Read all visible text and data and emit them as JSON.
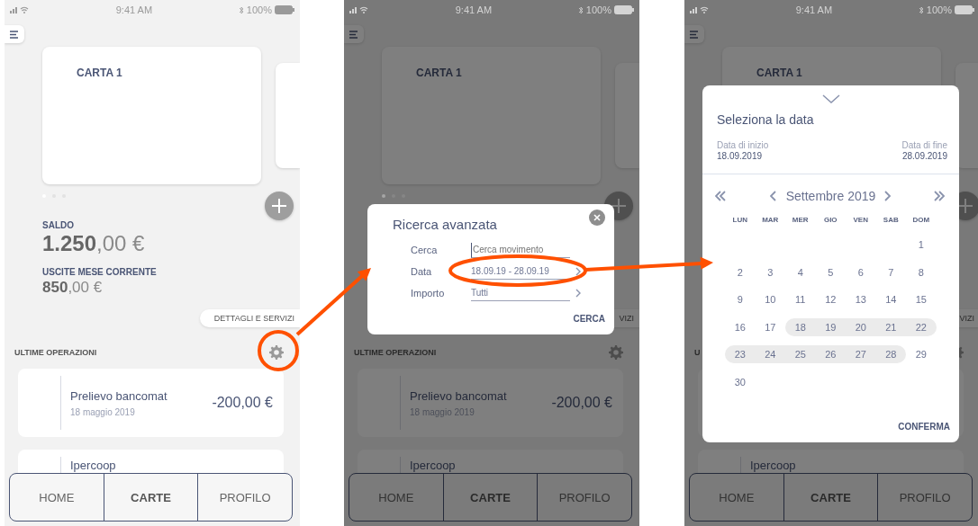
{
  "screens": [
    {
      "status_bar": {
        "time": "9:41 AM",
        "battery": "100%"
      },
      "card_title": "CARTA 1",
      "page_dots": [
        {
          "selected": true
        },
        {
          "selected": false
        },
        {
          "selected": false
        }
      ],
      "balance": {
        "label": "SALDO",
        "amount": "**1.250**,00 €"
      },
      "monthly_expenses": {
        "label": "USCITE MESE CORRENTE",
        "amount": "**850**,00 €"
      },
      "details_button": "DETTAGLI E SERVIZI",
      "operations_title": "ULTIME OPERAZIONI",
      "operations": [
        {
          "kind": "transaction",
          "title": "Prelievo bancomat",
          "date": "18 maggio 2019",
          "amount": "-200,00 €"
        },
        {
          "kind": "transaction",
          "title": "Ipercoop"
        }
      ],
      "nav": [
        {
          "label": "HOME",
          "selected": false
        },
        {
          "label": "CARTE",
          "selected": true
        },
        {
          "label": "PROFILO",
          "selected": false
        }
      ]
    },
    {
      "status_bar": {
        "time": "9:41 AM",
        "battery": "100%"
      },
      "card_title": "CARTA 1",
      "page_dots": [
        {
          "selected": true
        },
        {
          "selected": false
        },
        {
          "selected": false
        }
      ],
      "details_button": "VIZI",
      "operations_title": "ULTIME OPERAZIONI",
      "operations": [
        {
          "kind": "transaction",
          "title": "Prelievo bancomat",
          "date": "18 maggio 2019",
          "amount": "-200,00 €"
        },
        {
          "kind": "transaction",
          "title": "Ipercoop"
        }
      ],
      "nav": [
        {
          "label": "HOME",
          "selected": false
        },
        {
          "label": "CARTE",
          "selected": true
        },
        {
          "label": "PROFILO",
          "selected": false
        }
      ],
      "dialog": {
        "kind": "search",
        "title": "Ricerca avanzata",
        "fields": [
          {
            "label": "Cerca",
            "placeholder": "Cerca movimento"
          },
          {
            "label": "Data",
            "value": "18.09.19 - 28.09.19"
          },
          {
            "label": "Importo",
            "value": "Tutti"
          }
        ],
        "action": "CERCA"
      }
    },
    {
      "status_bar": {
        "time": "9:41 AM",
        "battery": "100%"
      },
      "card_title": "CARTA 1",
      "details_button": "VIZI",
      "operations_title": "U",
      "operations": [
        {
          "kind": "transaction"
        },
        {
          "kind": "transaction",
          "title": "Ipercoop"
        }
      ],
      "nav": [
        {
          "label": "HOME",
          "selected": false
        },
        {
          "label": "CARTE",
          "selected": true
        },
        {
          "label": "PROFILO",
          "selected": false
        }
      ],
      "dialog": {
        "kind": "date_picker",
        "title": "Seleziona la data",
        "start": {
          "label": "Data di inizio",
          "value": "18.09.2019"
        },
        "end": {
          "label": "Data di fine",
          "value": "28.09.2019"
        },
        "month": "Settembre 2019",
        "weekdays": [
          "LUN",
          "MAR",
          "MER",
          "GIO",
          "VEN",
          "SAB",
          "DOM"
        ],
        "weeks": [
          {
            "days": [
              {
                "day": "1",
                "in_range": false
              }
            ]
          },
          {
            "days": [
              {
                "day": "2",
                "in_range": false
              },
              {
                "day": "3",
                "in_range": false
              },
              {
                "day": "4",
                "in_range": false
              },
              {
                "day": "5",
                "in_range": false
              },
              {
                "day": "6",
                "in_range": false
              },
              {
                "day": "7",
                "in_range": false
              },
              {
                "day": "8",
                "in_range": false
              }
            ]
          },
          {
            "days": [
              {
                "day": "9",
                "in_range": false
              },
              {
                "day": "10",
                "in_range": false
              },
              {
                "day": "11",
                "in_range": false
              },
              {
                "day": "12",
                "in_range": false
              },
              {
                "day": "13",
                "in_range": false
              },
              {
                "day": "14",
                "in_range": false
              },
              {
                "day": "15",
                "in_range": false
              }
            ]
          },
          {
            "days": [
              {
                "day": "16",
                "in_range": false
              },
              {
                "day": "17",
                "in_range": false
              },
              {
                "day": "18",
                "in_range": true
              },
              {
                "day": "19",
                "in_range": true
              },
              {
                "day": "20",
                "in_range": true
              },
              {
                "day": "21",
                "in_range": true
              },
              {
                "day": "22",
                "in_range": true
              }
            ]
          },
          {
            "days": [
              {
                "day": "23",
                "in_range": true
              },
              {
                "day": "24",
                "in_range": true
              },
              {
                "day": "25",
                "in_range": true
              },
              {
                "day": "26",
                "in_range": true
              },
              {
                "day": "27",
                "in_range": true
              },
              {
                "day": "28",
                "in_range": true
              },
              {
                "day": "29",
                "in_range": false
              }
            ]
          },
          {
            "days": [
              {
                "day": "30",
                "in_range": false
              }
            ]
          }
        ],
        "action": "CONFERMA"
      }
    }
  ]
}
